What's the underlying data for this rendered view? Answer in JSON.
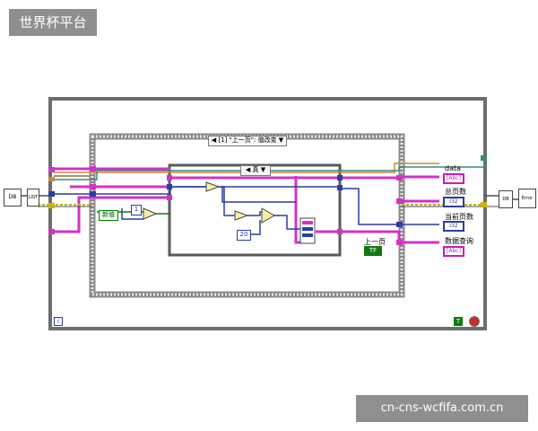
{
  "brand": {
    "title": "世界杯平台"
  },
  "watermark": {
    "text": "cn-cns-wcfifa.com.cn"
  },
  "outer_case": {
    "selector": "◀ [1] \"上一页\": 值改变 ▼"
  },
  "inner_case": {
    "selector": "◀ 真 ▼"
  },
  "controls": {
    "new_value": "新值",
    "const_one": "1",
    "const_twenty": "20",
    "prev_page_button": "上一页",
    "prev_page_terminal": "TF"
  },
  "indicators": {
    "data_label": "data",
    "data_terminal": "[Abc]",
    "total_pages_label": "总页数",
    "total_pages_terminal": "I32",
    "current_page_label": "当前页数",
    "current_page_terminal": "I32",
    "query_label": "数据查询",
    "query_terminal": "[Abc]"
  },
  "footer": {
    "info_icon": "i",
    "loop_true": "T"
  },
  "nodes": {
    "left_a": "DB",
    "left_b": "LIST",
    "right_a": "DB",
    "right_b": "Error"
  },
  "colors": {
    "string_wire": "#d331c8",
    "numeric_wire": "#2b3f9a",
    "bool_wire": "#0f7a0f",
    "cluster_wire": "#8a6d3b",
    "error_wire": "#c9b400",
    "frame": "#7a7a7a"
  }
}
